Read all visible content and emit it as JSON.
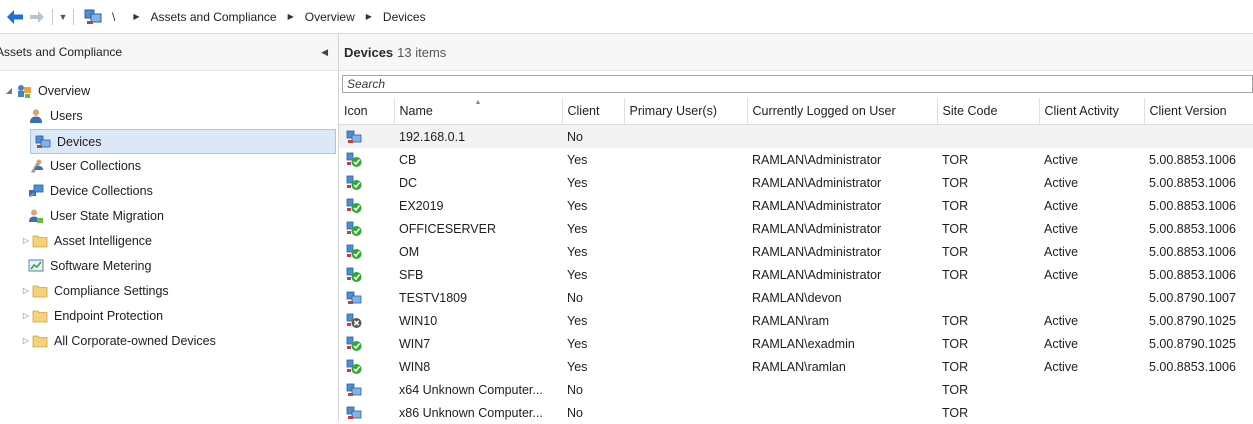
{
  "breadcrumb": {
    "root_sep": "\\",
    "items": [
      "Assets and Compliance",
      "Overview",
      "Devices"
    ]
  },
  "nav": {
    "header": "Assets and Compliance",
    "items": [
      {
        "label": "Overview",
        "icon": "overview-icon",
        "expander": "◢"
      },
      {
        "label": "Users",
        "icon": "users-icon"
      },
      {
        "label": "Devices",
        "icon": "devices-icon",
        "selected": true
      },
      {
        "label": "User Collections",
        "icon": "user-collections-icon"
      },
      {
        "label": "Device Collections",
        "icon": "device-collections-icon"
      },
      {
        "label": "User State Migration",
        "icon": "user-state-migration-icon"
      },
      {
        "label": "Asset Intelligence",
        "icon": "folder-icon",
        "expander": "▷"
      },
      {
        "label": "Software Metering",
        "icon": "software-metering-icon"
      },
      {
        "label": "Compliance Settings",
        "icon": "folder-icon",
        "expander": "▷"
      },
      {
        "label": "Endpoint Protection",
        "icon": "folder-icon",
        "expander": "▷"
      },
      {
        "label": "All Corporate-owned Devices",
        "icon": "folder-icon",
        "expander": "▷"
      }
    ]
  },
  "main": {
    "title": "Devices",
    "count": "13 items",
    "search_placeholder": "Search",
    "columns": [
      "Icon",
      "Name",
      "Client",
      "Primary User(s)",
      "Currently Logged on User",
      "Site Code",
      "Client Activity",
      "Client Version"
    ],
    "rows": [
      {
        "status": "none",
        "name": "192.168.0.1",
        "client": "No",
        "primary": "",
        "logged": "",
        "site": "",
        "activity": "",
        "version": ""
      },
      {
        "status": "ok",
        "name": "CB",
        "client": "Yes",
        "primary": "",
        "logged": "RAMLAN\\Administrator",
        "site": "TOR",
        "activity": "Active",
        "version": "5.00.8853.1006"
      },
      {
        "status": "ok",
        "name": "DC",
        "client": "Yes",
        "primary": "",
        "logged": "RAMLAN\\Administrator",
        "site": "TOR",
        "activity": "Active",
        "version": "5.00.8853.1006"
      },
      {
        "status": "ok",
        "name": "EX2019",
        "client": "Yes",
        "primary": "",
        "logged": "RAMLAN\\Administrator",
        "site": "TOR",
        "activity": "Active",
        "version": "5.00.8853.1006"
      },
      {
        "status": "ok",
        "name": "OFFICESERVER",
        "client": "Yes",
        "primary": "",
        "logged": "RAMLAN\\Administrator",
        "site": "TOR",
        "activity": "Active",
        "version": "5.00.8853.1006"
      },
      {
        "status": "ok",
        "name": "OM",
        "client": "Yes",
        "primary": "",
        "logged": "RAMLAN\\Administrator",
        "site": "TOR",
        "activity": "Active",
        "version": "5.00.8853.1006"
      },
      {
        "status": "ok",
        "name": "SFB",
        "client": "Yes",
        "primary": "",
        "logged": "RAMLAN\\Administrator",
        "site": "TOR",
        "activity": "Active",
        "version": "5.00.8853.1006"
      },
      {
        "status": "none",
        "name": "TESTV1809",
        "client": "No",
        "primary": "",
        "logged": "RAMLAN\\devon",
        "site": "",
        "activity": "",
        "version": "5.00.8790.1007"
      },
      {
        "status": "error",
        "name": "WIN10",
        "client": "Yes",
        "primary": "",
        "logged": "RAMLAN\\ram",
        "site": "TOR",
        "activity": "Active",
        "version": "5.00.8790.1025"
      },
      {
        "status": "ok",
        "name": "WIN7",
        "client": "Yes",
        "primary": "",
        "logged": "RAMLAN\\exadmin",
        "site": "TOR",
        "activity": "Active",
        "version": "5.00.8790.1025"
      },
      {
        "status": "ok",
        "name": "WIN8",
        "client": "Yes",
        "primary": "",
        "logged": "RAMLAN\\ramlan",
        "site": "TOR",
        "activity": "Active",
        "version": "5.00.8853.1006"
      },
      {
        "status": "none",
        "name": "x64 Unknown Computer...",
        "client": "No",
        "primary": "",
        "logged": "",
        "site": "TOR",
        "activity": "",
        "version": ""
      },
      {
        "status": "none",
        "name": "x86 Unknown Computer...",
        "client": "No",
        "primary": "",
        "logged": "",
        "site": "TOR",
        "activity": "",
        "version": ""
      }
    ]
  },
  "colors": {
    "back_arrow": "#1e6fd9",
    "selection_bg": "#dbe8f8",
    "status_ok": "#2fa82f",
    "status_error": "#5a5a5a"
  }
}
